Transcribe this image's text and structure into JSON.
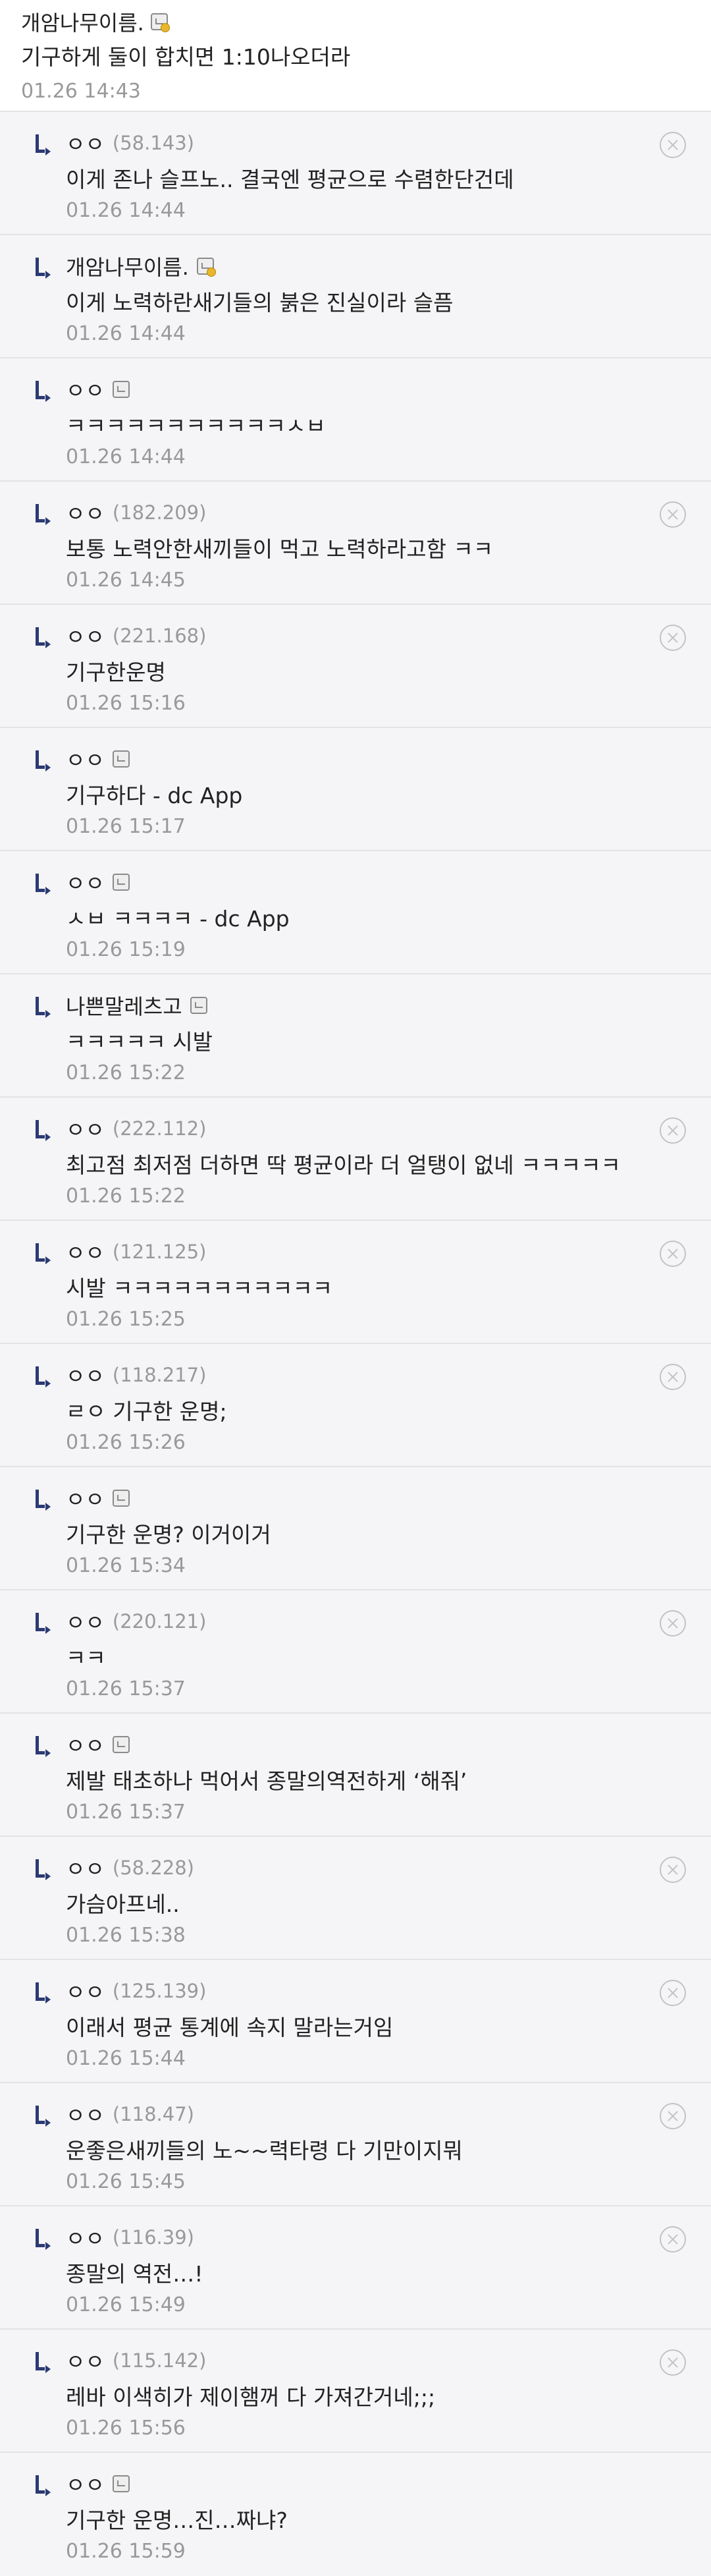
{
  "main_comment": {
    "author": "개암나무이름.",
    "text": "기구하게 둘이 합치면 1:10나오더라",
    "date": "01.26 14:43"
  },
  "replies": [
    {
      "nick": "ㅇㅇ",
      "ip": "(58.143)",
      "text": "이게 존나 슬프노.. 결국엔 평균으로 수렴한단건데",
      "date": "01.26 14:44"
    },
    {
      "nick": "개암나무이름.",
      "ip": "",
      "text": "이게 노력하란새기들의 붉은 진실이라 슬픔",
      "date": "01.26 14:44"
    },
    {
      "nick": "ㅇㅇ",
      "ip": "",
      "text": "ㅋㅋㅋㅋㅋㅋㅋㅋㅋㅋㅋㅅㅂ",
      "date": "01.26 14:44"
    },
    {
      "nick": "ㅇㅇ",
      "ip": "(182.209)",
      "text": "보통 노력안한새끼들이 먹고 노력하라고함 ㅋㅋ",
      "date": "01.26 14:45"
    },
    {
      "nick": "ㅇㅇ",
      "ip": "(221.168)",
      "text": "기구한운명",
      "date": "01.26 15:16"
    },
    {
      "nick": "ㅇㅇ",
      "ip": "",
      "text": "기구하다 - dc App",
      "date": "01.26 15:17"
    },
    {
      "nick": "ㅇㅇ",
      "ip": "",
      "text": "ㅅㅂ ㅋㅋㅋㅋ - dc App",
      "date": "01.26 15:19"
    },
    {
      "nick": "나쁜말레츠고",
      "ip": "",
      "text": "ㅋㅋㅋㅋㅋ 시발",
      "date": "01.26 15:22"
    },
    {
      "nick": "ㅇㅇ",
      "ip": "(222.112)",
      "text": "최고점 최저점 더하면 딱 평균이라 더 얼탱이 없네 ㅋㅋㅋㅋㅋ",
      "date": "01.26 15:22"
    },
    {
      "nick": "ㅇㅇ",
      "ip": "(121.125)",
      "text": "시발 ㅋㅋㅋㅋㅋㅋㅋㅋㅋㅋㅋ",
      "date": "01.26 15:25"
    },
    {
      "nick": "ㅇㅇ",
      "ip": "(118.217)",
      "text": "ㄹㅇ 기구한 운명;",
      "date": "01.26 15:26"
    },
    {
      "nick": "ㅇㅇ",
      "ip": "",
      "text": "기구한 운명? 이거이거",
      "date": "01.26 15:34"
    },
    {
      "nick": "ㅇㅇ",
      "ip": "(220.121)",
      "text": "ㅋㅋ",
      "date": "01.26 15:37"
    },
    {
      "nick": "ㅇㅇ",
      "ip": "",
      "text": "제발 태초하나 먹어서 종말의역전하게 ‘해줘’",
      "date": "01.26 15:37"
    },
    {
      "nick": "ㅇㅇ",
      "ip": "(58.228)",
      "text": "가슴아프네..",
      "date": "01.26 15:38"
    },
    {
      "nick": "ㅇㅇ",
      "ip": "(125.139)",
      "text": "이래서 평균 통계에 속지 말라는거임",
      "date": "01.26 15:44"
    },
    {
      "nick": "ㅇㅇ",
      "ip": "(118.47)",
      "text": "운좋은새끼들의 노~~력타령 다 기만이지뭐",
      "date": "01.26 15:45"
    },
    {
      "nick": "ㅇㅇ",
      "ip": "(116.39)",
      "text": "종말의 역전…!",
      "date": "01.26 15:49"
    },
    {
      "nick": "ㅇㅇ",
      "ip": "(115.142)",
      "text": "레바 이색히가 제이햄꺼 다 가져간거네;;;",
      "date": "01.26 15:56"
    },
    {
      "nick": "ㅇㅇ",
      "ip": "",
      "text": "기구한 운명…진…짜냐?",
      "date": "01.26 15:59"
    }
  ]
}
